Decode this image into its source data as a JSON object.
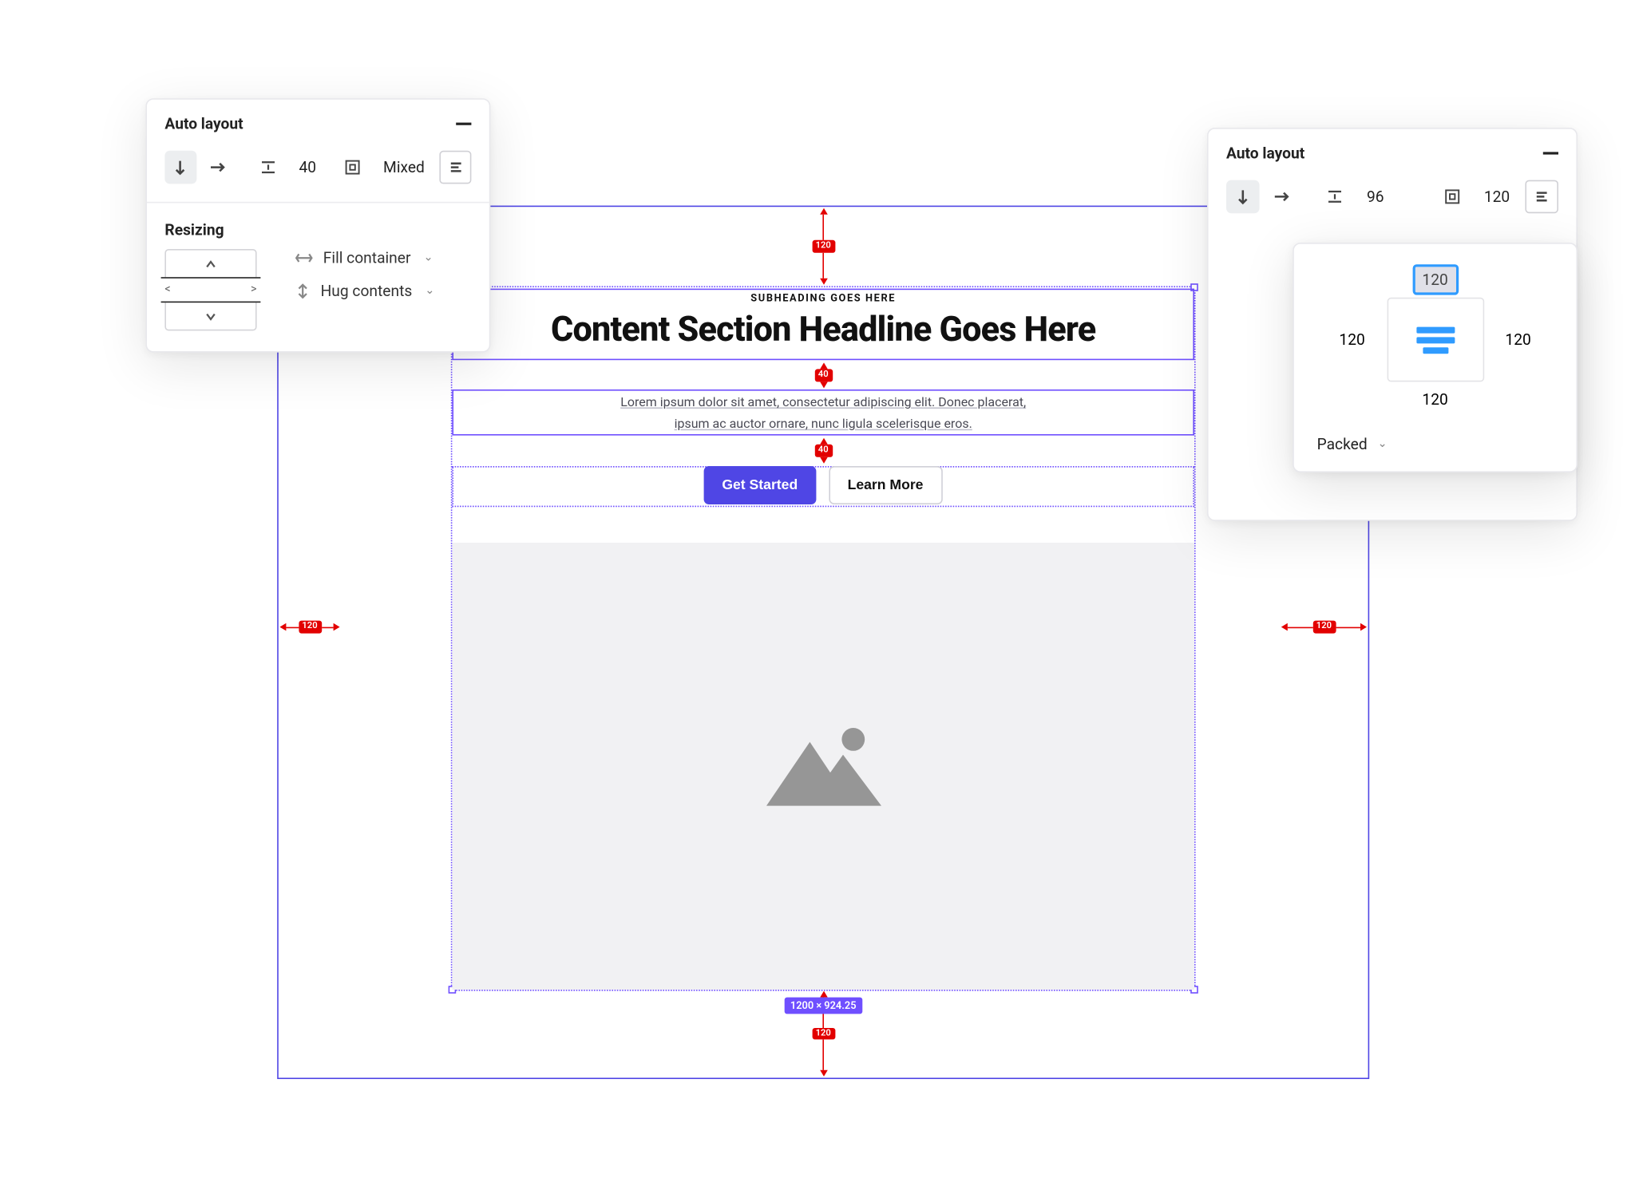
{
  "left_panel": {
    "title": "Auto layout",
    "gap_value": "40",
    "padding_mode": "Mixed",
    "resizing_title": "Resizing",
    "horizontal_mode": "Fill container",
    "vertical_mode": "Hug contents"
  },
  "right_panel": {
    "title": "Auto layout",
    "gap_value": "96",
    "padding_value": "120"
  },
  "padding_popover": {
    "top": "120",
    "right": "120",
    "bottom": "120",
    "left": "120",
    "distribution": "Packed"
  },
  "canvas": {
    "outer_padding": {
      "top": "120",
      "right": "120",
      "bottom": "120",
      "left": "120"
    },
    "gap1": "40",
    "gap2": "40",
    "subheading": "SUBHEADING GOES HERE",
    "headline": "Content Section Headline Goes Here",
    "body_line1": "Lorem ipsum dolor sit amet, consectetur adipiscing elit. Donec placerat,",
    "body_line2": "ipsum ac auctor ornare, nunc ligula scelerisque eros.",
    "primary_btn": "Get Started",
    "secondary_btn": "Learn More",
    "size_label": "1200 × 924.25"
  }
}
